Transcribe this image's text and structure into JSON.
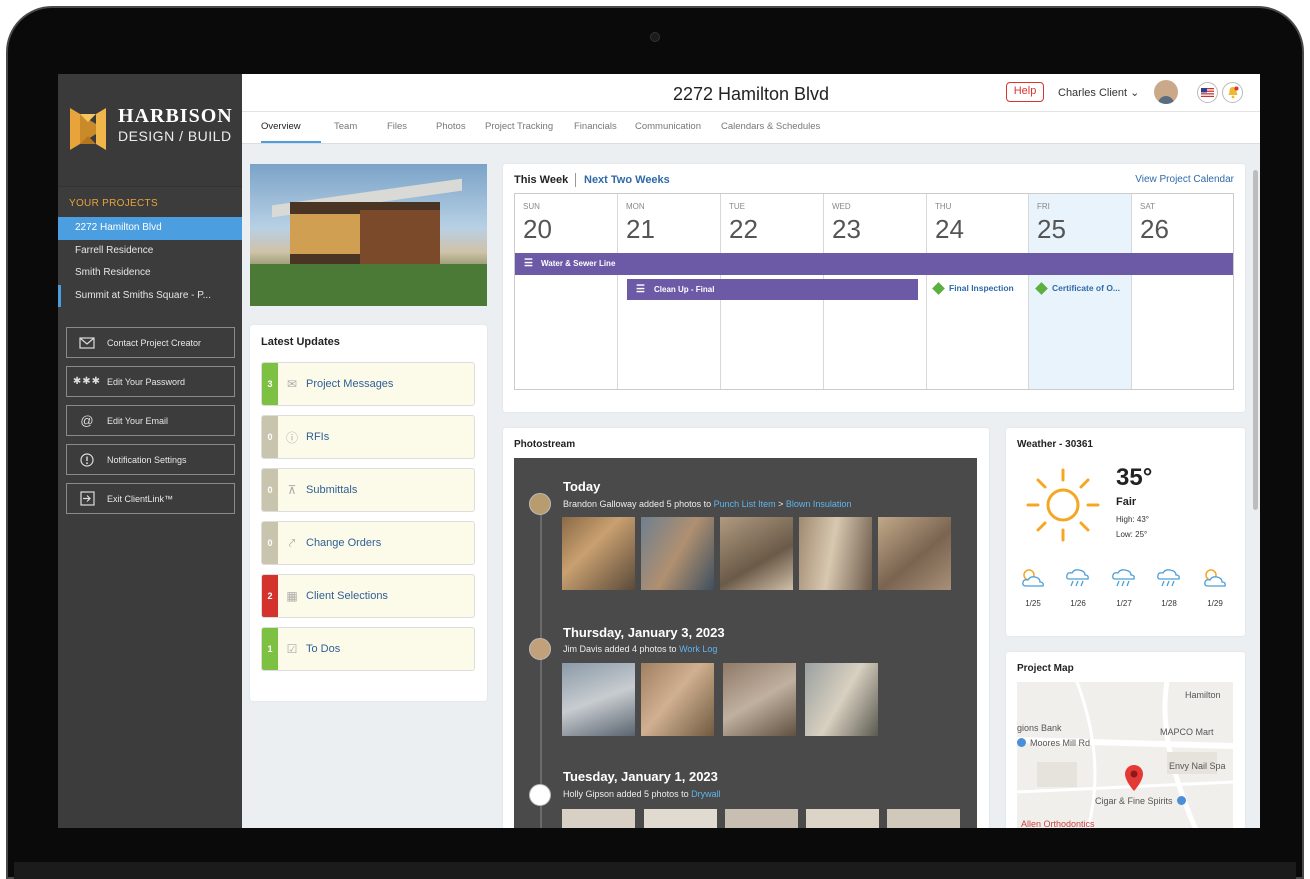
{
  "brand": {
    "name_line1": "HARBISON",
    "name_line2": "DESIGN / BUILD"
  },
  "sidebar": {
    "projects_heading": "YOUR PROJECTS",
    "projects": [
      "2272 Hamilton Blvd",
      "Farrell Residence",
      "Smith Residence",
      "Summit at Smiths Square - P..."
    ],
    "buttons": [
      {
        "label": "Contact Project Creator",
        "icon": "envelope-icon"
      },
      {
        "label": "Edit Your Password",
        "icon": "password-icon"
      },
      {
        "label": "Edit Your Email",
        "icon": "at-icon"
      },
      {
        "label": "Notification Settings",
        "icon": "alert-icon"
      },
      {
        "label": "Exit ClientLink™",
        "icon": "exit-icon"
      }
    ]
  },
  "header": {
    "title": "2272 Hamilton Blvd",
    "help": "Help",
    "user": "Charles Client ⌄"
  },
  "tabs": [
    "Overview",
    "Team",
    "Files",
    "Photos",
    "Project Tracking",
    "Financials",
    "Communication",
    "Calendars & Schedules"
  ],
  "updates": {
    "title": "Latest Updates",
    "items": [
      {
        "count": "3",
        "label": "Project Messages",
        "color": "#7dc142",
        "icon": "envelope-icon"
      },
      {
        "count": "0",
        "label": "RFIs",
        "color": "#c9c4ad",
        "icon": "info-icon"
      },
      {
        "count": "0",
        "label": "Submittals",
        "color": "#c9c4ad",
        "icon": "stamp-icon"
      },
      {
        "count": "0",
        "label": "Change Orders",
        "color": "#c9c4ad",
        "icon": "arrows-icon"
      },
      {
        "count": "2",
        "label": "Client Selections",
        "color": "#d3332c",
        "icon": "swatch-icon"
      },
      {
        "count": "1",
        "label": "To Dos",
        "color": "#7dc142",
        "icon": "checkbox-icon"
      }
    ]
  },
  "calendar": {
    "this_week": "This Week",
    "next_two": "Next Two Weeks",
    "view_link": "View Project Calendar",
    "days": [
      {
        "name": "SUN",
        "date": "20"
      },
      {
        "name": "MON",
        "date": "21"
      },
      {
        "name": "TUE",
        "date": "22"
      },
      {
        "name": "WED",
        "date": "23"
      },
      {
        "name": "THU",
        "date": "24"
      },
      {
        "name": "FRI",
        "date": "25"
      },
      {
        "name": "SAT",
        "date": "26"
      }
    ],
    "events": {
      "bar1": "Water & Sewer Line",
      "bar2": "Clean Up - Final",
      "ms1": "Final Inspection",
      "ms2": "Certificate of O..."
    }
  },
  "photostream": {
    "title": "Photostream",
    "groups": [
      {
        "heading": "Today",
        "who": "Brandon Galloway added 5 photos to ",
        "link1": "Punch List Item",
        "sep": " > ",
        "link2": "Blown Insulation"
      },
      {
        "heading": "Thursday, January 3, 2023",
        "who": "Jim Davis added 4 photos to ",
        "link1": "Work Log"
      },
      {
        "heading": "Tuesday, January 1, 2023",
        "who": "Holly Gipson added 5 photos to ",
        "link1": "Drywall"
      }
    ]
  },
  "weather": {
    "title": "Weather - 30361",
    "temp": "35°",
    "cond": "Fair",
    "high": "High: 43°",
    "low": "Low: 25°",
    "forecast": [
      {
        "day": "1/25",
        "icon": "partly-sunny-icon"
      },
      {
        "day": "1/26",
        "icon": "rain-icon"
      },
      {
        "day": "1/27",
        "icon": "rain-icon"
      },
      {
        "day": "1/28",
        "icon": "rain-icon"
      },
      {
        "day": "1/29",
        "icon": "partly-sunny-icon"
      }
    ]
  },
  "map": {
    "title": "Project Map",
    "labels": [
      "Hamilton",
      "gions Bank",
      "Moores Mill Rd",
      "MAPCO Mart",
      "Envy Nail Spa",
      "Cigar & Fine Spirits",
      "Allen Orthodontics"
    ]
  }
}
